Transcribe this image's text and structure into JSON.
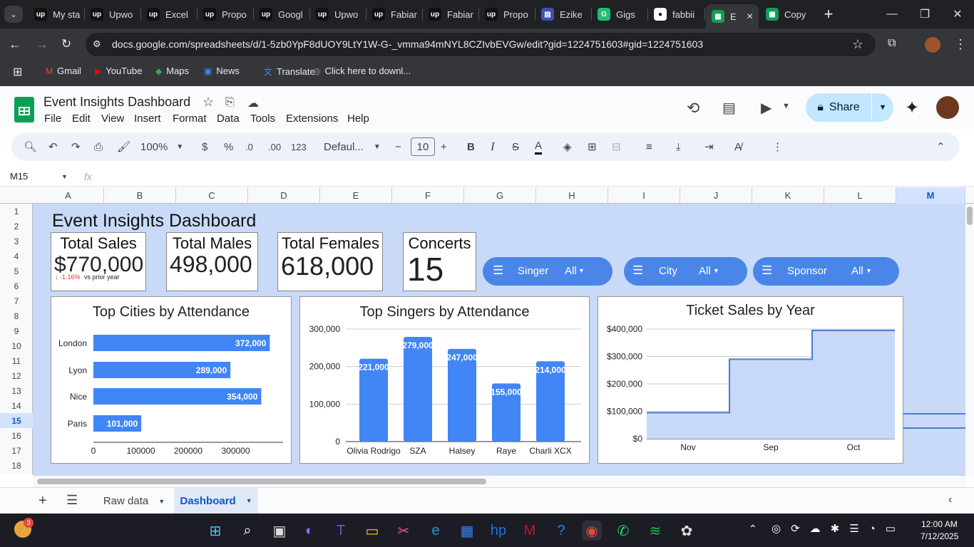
{
  "browser": {
    "tabs": [
      {
        "label": "My sta",
        "icon": "upwork-icon"
      },
      {
        "label": "Upwo",
        "icon": "upwork-icon"
      },
      {
        "label": "Excel",
        "icon": "upwork-icon"
      },
      {
        "label": "Propo",
        "icon": "upwork-icon"
      },
      {
        "label": "Googl",
        "icon": "upwork-icon"
      },
      {
        "label": "Upwo",
        "icon": "upwork-icon"
      },
      {
        "label": "Fabiar",
        "icon": "upwork-icon"
      },
      {
        "label": "Fabiar",
        "icon": "upwork-icon"
      },
      {
        "label": "Propo",
        "icon": "upwork-icon"
      },
      {
        "label": "Ezike",
        "icon": "forms-icon"
      },
      {
        "label": "Gigs",
        "icon": "fiverr-icon"
      },
      {
        "label": "fabbii",
        "icon": "github-icon"
      },
      {
        "label": "E",
        "icon": "sheets-icon"
      },
      {
        "label": "Copy",
        "icon": "sheets-icon"
      }
    ],
    "url": "docs.google.com/spreadsheets/d/1-5zb0YpF8dUOY9LtY1W-G-_vmma94mNYL8CZIvbEVGw/edit?gid=1224751603#gid=1224751603",
    "bookmarks": [
      "Gmail",
      "YouTube",
      "Maps",
      "News",
      "Translate",
      "Click here to downl..."
    ]
  },
  "doc": {
    "title": "Event Insights Dashboard",
    "menus": [
      "File",
      "Edit",
      "View",
      "Insert",
      "Format",
      "Data",
      "Tools",
      "Extensions",
      "Help"
    ],
    "share_label": "Share",
    "zoom": "100%",
    "currency": "$",
    "percent": "%",
    "dec_decrease": ".0",
    "dec_increase": ".00",
    "format_123": "123",
    "font": "Defaul...",
    "font_size": "10",
    "bold": "B",
    "italic": "I",
    "strike": "S",
    "text_color": "A",
    "namebox": "M15",
    "fx": "fx"
  },
  "grid": {
    "columns": [
      "A",
      "B",
      "C",
      "D",
      "E",
      "F",
      "G",
      "H",
      "I",
      "J",
      "K",
      "L",
      "M"
    ],
    "rows": [
      "1",
      "2",
      "3",
      "4",
      "5",
      "6",
      "7",
      "8",
      "9",
      "10",
      "11",
      "12",
      "13",
      "14",
      "15",
      "16",
      "17",
      "18"
    ],
    "selected_column": "M",
    "selected_row": "15"
  },
  "dashboard": {
    "title": "Event Insights Dashboard",
    "kpis": [
      {
        "title": "Total Sales",
        "value": "$770,000",
        "delta": "↓ -1.16%",
        "delta_note": "vs prior year"
      },
      {
        "title": "Total Males",
        "value": "498,000"
      },
      {
        "title": "Total Females",
        "value": "618,000"
      },
      {
        "title": "Concerts",
        "value": "15"
      }
    ],
    "slicers": [
      {
        "label": "Singer",
        "value": "All"
      },
      {
        "label": "City",
        "value": "All"
      },
      {
        "label": "Sponsor",
        "value": "All"
      }
    ],
    "colors": {
      "accent": "#4285f4",
      "slicer": "#4a86e8",
      "canvas": "#c9daf8",
      "area": "#c6d9f8"
    }
  },
  "chart_data": [
    {
      "type": "bar",
      "orientation": "horizontal",
      "title": "Top Cities by Attendance",
      "categories": [
        "London",
        "Lyon",
        "Nice",
        "Paris"
      ],
      "values": [
        372000,
        289000,
        354000,
        101000
      ],
      "labels": [
        "372,000",
        "289,000",
        "354,000",
        "101,000"
      ],
      "xticks": [
        "0",
        "100000",
        "200000",
        "300000"
      ],
      "xlim": [
        0,
        400000
      ],
      "grid": false
    },
    {
      "type": "bar",
      "title": "Top Singers by Attendance",
      "categories": [
        "Olivia Rodrigo",
        "SZA",
        "Halsey",
        "Raye",
        "Charli XCX"
      ],
      "values": [
        221000,
        279000,
        247000,
        155000,
        214000
      ],
      "labels": [
        "221,000",
        "279,000",
        "247,000",
        "155,000",
        "214,000"
      ],
      "yticks": [
        "0",
        "100,000",
        "200,000",
        "300,000"
      ],
      "ylim": [
        0,
        300000
      ],
      "grid": true
    },
    {
      "type": "area",
      "title": "Ticket Sales by Year",
      "categories": [
        "Nov",
        "Sep",
        "Oct"
      ],
      "values": [
        95000,
        290000,
        395000
      ],
      "yticks": [
        "$0",
        "$100,000",
        "$200,000",
        "$300,000",
        "$400,000"
      ],
      "ylim": [
        0,
        400000
      ],
      "grid": true
    }
  ],
  "sheets": {
    "tabs": [
      "Raw data",
      "Dashboard"
    ],
    "active": "Dashboard"
  },
  "taskbar": {
    "time": "12:00 AM",
    "date": "7/12/2025",
    "badge": "3"
  }
}
